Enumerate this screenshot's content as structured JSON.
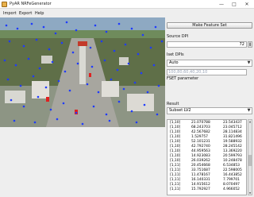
{
  "window": {
    "title": "PyAR NRFeGenerator",
    "controls": {
      "minimize": "—",
      "maximize": "□",
      "close": "✕"
    }
  },
  "menu": {
    "items": [
      "Import",
      "Export",
      "Help"
    ]
  },
  "panel": {
    "make_button": "Make Feature Set",
    "source_dpi_label": "Source DPI",
    "source_dpi_value": "72",
    "target_dpi_label": "Iset DPIs",
    "target_dpi_selected": "Auto",
    "dpi_list_text": "100,80,60,40,20,10",
    "fset_label": "FSET parameter",
    "fset_selected": "Subset LV2",
    "result_label": "Result",
    "result_rows": [
      [
        "[1,10]",
        "21.070788",
        "23.543437"
      ],
      [
        "[1,10]",
        "68.243703",
        "23.045712"
      ],
      [
        "[1,10]",
        "42.567682",
        "28.114834"
      ],
      [
        "[1,10]",
        "1.529757",
        "31.821496"
      ],
      [
        "[1,10]",
        "52.101231",
        "19.588932"
      ],
      [
        "[1,10]",
        "42.792740",
        "28.245142"
      ],
      [
        "[1,10]",
        "44.959563",
        "13.369220"
      ],
      [
        "[1,10]",
        "14.923083",
        "20.599793"
      ],
      [
        "[1,10]",
        "26.039262",
        "10.248478"
      ],
      [
        "[1,11]",
        "20.454668",
        "6.534853"
      ],
      [
        "[1,11]",
        "33.751687",
        "22.598005"
      ],
      [
        "[1,11]",
        "11.478167",
        "16.443852"
      ],
      [
        "[1,11]",
        "16.140331",
        "7.799701"
      ],
      [
        "[1,11]",
        "14.915612",
        "8.070497"
      ],
      [
        "[1,11]",
        "15.792927",
        "4.966052"
      ]
    ]
  },
  "colors": {
    "feature_point": "#1f3bff",
    "feature_point_red": "#e02020",
    "accent": "#9aa4b8"
  },
  "icons": {
    "app": "app-icon",
    "dropdown": "chevron-down-icon",
    "scroll_up": "scroll-up-icon",
    "scroll_down": "scroll-down-icon"
  }
}
